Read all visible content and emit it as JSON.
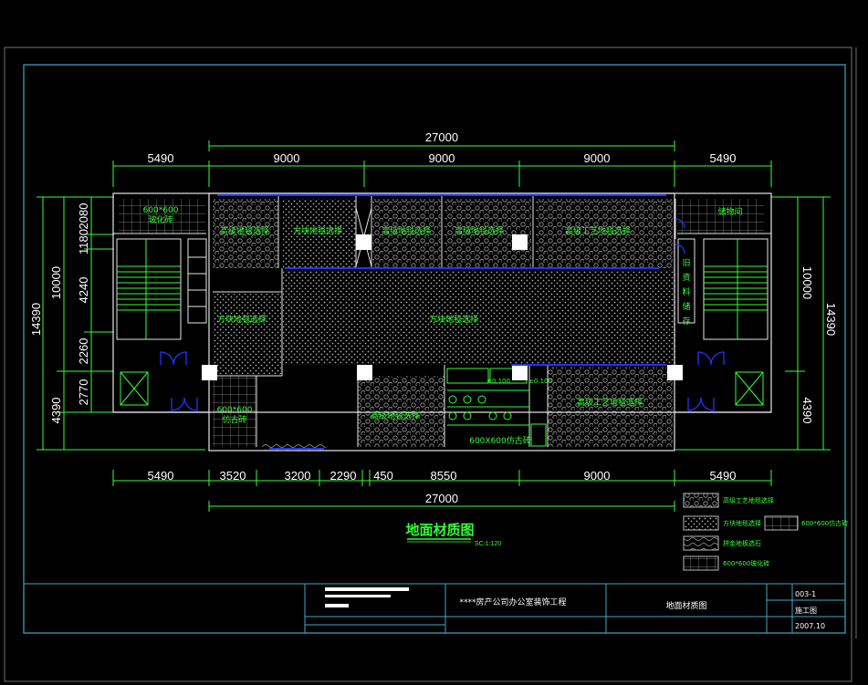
{
  "drawing": {
    "title": "地面材质图",
    "scale": "SC:1:120",
    "colors": {
      "frame": "#3fa9c9",
      "wall": "#e0e0e0",
      "dim": "#33ff33",
      "room": "#33ff33",
      "hatch": "#9a9a9a",
      "blue_line": "#2233ff",
      "title": "#33ff33",
      "background": "#000000"
    }
  },
  "dimensions": {
    "top_total": "27000",
    "top": [
      "5490",
      "9000",
      "9000",
      "9000",
      "5490"
    ],
    "bottom": [
      "5490",
      "3520",
      "3200",
      "2290",
      "450",
      "8550",
      "9000",
      "5490"
    ],
    "bottom_total": "27000",
    "left_outer": [
      "14390",
      "4390"
    ],
    "left_inner": [
      "2080",
      "1180",
      "10000",
      "4240",
      "2260",
      "2770"
    ],
    "right_outer": [
      "14390",
      "4390"
    ],
    "right_inner": "10000"
  },
  "rooms": {
    "r1": "600*600",
    "r1b": "玻化砖",
    "r2": "高级地毯选择",
    "r3": "方块地毯选择",
    "r4": "高级地毯选择",
    "r5": "高级地毯选择",
    "r6": "高级工艺地毯选择",
    "r7": "储物间",
    "r8": "方块地毯选择",
    "r9": "方块地毯选择",
    "r10": "600*600",
    "r10b": "仿古砖",
    "r11": "高级地毯选择",
    "r12": "600X600仿古砖",
    "r13": "高级工艺地毯选择",
    "r14": [
      "旧",
      "资",
      "料",
      "储",
      "存"
    ],
    "r15": "±0.100",
    "r16": "±0.100"
  },
  "legend": [
    {
      "label": "高级工艺地毯选择"
    },
    {
      "label": "方块地毯选择"
    },
    {
      "label": "600*600仿古砖"
    },
    {
      "label": "拼金地板选石"
    },
    {
      "label": "600*600玻化砖"
    }
  ],
  "title_block": {
    "project": "****房产公司办公室装饰工程",
    "drawing_name": "地面材质图",
    "number": "003-1",
    "stage": "施工图",
    "date": "2007.10"
  }
}
